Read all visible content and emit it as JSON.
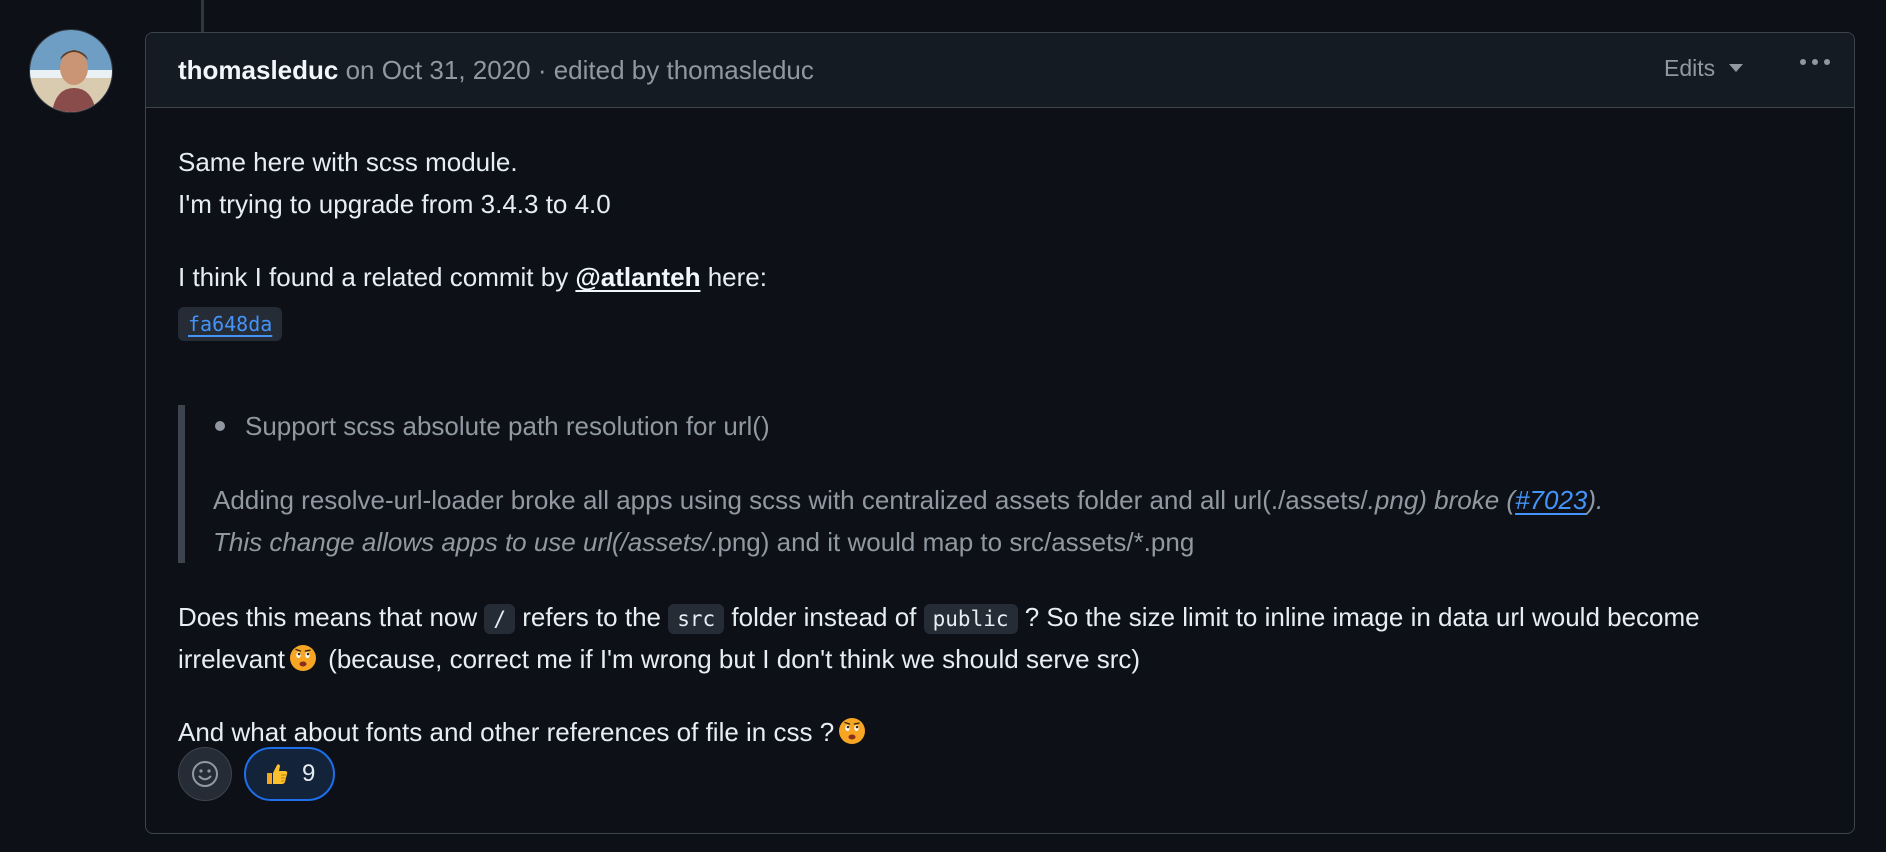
{
  "header": {
    "author": "thomasleduc",
    "meta": " on Oct 31, 2020 · edited by thomasleduc",
    "edits_label": "Edits"
  },
  "body": {
    "line1": "Same here with scss module.",
    "line2": "I'm trying to upgrade from 3.4.3 to 4.0",
    "p2_before": "I think I found a related commit by ",
    "mention": "@atlanteh",
    "p2_after": " here:",
    "commit": "fa648da",
    "quote": {
      "bullet": "Support scss absolute path resolution for url()",
      "line1_a": "Adding resolve-url-loader broke all apps using scss with centralized assets folder and all url(./assets/",
      "line1_b": ".png) broke (",
      "issue": "#7023",
      "line1_c": ").",
      "line2_a": "This change allows apps to use url(/assets/",
      "line2_b": ".png) and it would map to src/assets/*.png"
    },
    "p3_a": "Does this means that now ",
    "code_slash": "/",
    "p3_b": " refers to the ",
    "code_src": "src",
    "p3_c": " folder instead of ",
    "code_public": "public",
    "p3_d": " ? So the size limit to inline image in data url would become",
    "p3_e": "irrelevant",
    "p3_f": " (because, correct me if I'm wrong but I don't think we should serve src)",
    "p4": "And what about fonts and other references of file in css ?"
  },
  "reactions": {
    "thumbs_up_count": "9"
  },
  "colors": {
    "background": "#0d1117",
    "header_bg": "#151b23",
    "border": "#3d444d",
    "link": "#4493f8",
    "muted": "#9198a1",
    "accent": "#1f6feb"
  },
  "icons": [
    "avatar",
    "caret-down-icon",
    "kebab-icon",
    "thinking-face-emoji",
    "smiley-icon",
    "thumbs-up-emoji"
  ]
}
